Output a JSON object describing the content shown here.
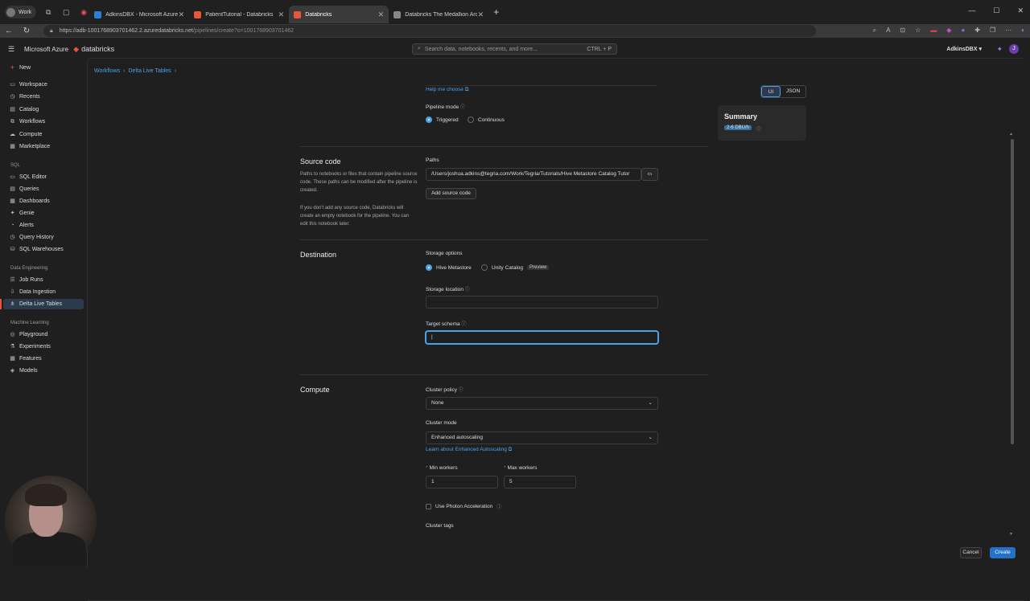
{
  "browser": {
    "profile": "Work",
    "tabs": [
      {
        "title": "AdkinsDBX - Microsoft Azure",
        "color": "#2b7fd6"
      },
      {
        "title": "PatientTutorial - Databricks",
        "color": "#e8553a"
      },
      {
        "title": "Databricks",
        "color": "#e8553a"
      },
      {
        "title": "Databricks The Medallion Archite",
        "color": "#888888"
      }
    ],
    "url_host": "https://adb-1001768903701462.2.azuredatabricks.net",
    "url_path": "/pipelines/create?o=1001768903701462"
  },
  "header": {
    "brand_azure": "Microsoft Azure",
    "brand_databricks": "databricks",
    "search_placeholder": "Search data, notebooks, recents, and more...",
    "search_shortcut": "CTRL + P",
    "account": "AdkinsDBX",
    "avatar_letter": "J"
  },
  "sidebar": {
    "new_label": "New",
    "items": [
      "Workspace",
      "Recents",
      "Catalog",
      "Workflows",
      "Compute",
      "Marketplace"
    ],
    "sql_section": "SQL",
    "sql_items": [
      "SQL Editor",
      "Queries",
      "Dashboards",
      "Genie",
      "Alerts",
      "Query History",
      "SQL Warehouses"
    ],
    "de_section": "Data Engineering",
    "de_items": [
      "Job Runs",
      "Data Ingestion",
      "Delta Live Tables"
    ],
    "ml_section": "Machine Learning",
    "ml_items": [
      "Playground",
      "Experiments",
      "Features",
      "Models"
    ]
  },
  "breadcrumbs": [
    "Workflows",
    "Delta Live Tables"
  ],
  "view_toggle": {
    "ui": "UI",
    "json": "JSON"
  },
  "summary": {
    "title": "Summary",
    "dbu": "2-6 DBU/h"
  },
  "form": {
    "help_link": "Help me choose",
    "pipeline_mode_label": "Pipeline mode",
    "mode_triggered": "Triggered",
    "mode_continuous": "Continuous",
    "source": {
      "title": "Source code",
      "desc1": "Paths to notebooks or files that contain pipeline source code. These paths can be modified after the pipeline is created.",
      "desc2": "If you don't add any source code, Databricks will create an empty notebook for the pipeline. You can edit this notebook later.",
      "paths_label": "Paths",
      "path_value": "/Users/joshua.adkins@tegria.com/Work/Tegria/Tutorials/Hive Metastore Catalog Tutor",
      "add_button": "Add source code"
    },
    "destination": {
      "title": "Destination",
      "storage_options_label": "Storage options",
      "hive": "Hive Metastore",
      "unity": "Unity Catalog",
      "preview": "Preview",
      "storage_location_label": "Storage location",
      "storage_location_value": "",
      "target_schema_label": "Target schema",
      "target_schema_value": ""
    },
    "compute": {
      "title": "Compute",
      "cluster_policy_label": "Cluster policy",
      "cluster_policy_value": "None",
      "cluster_mode_label": "Cluster mode",
      "cluster_mode_value": "Enhanced autoscaling",
      "learn_link": "Learn about Enhanced Autoscaling",
      "min_workers_label": "Min workers",
      "min_workers_value": "1",
      "max_workers_label": "Max workers",
      "max_workers_value": "5",
      "photon_label": "Use Photon Acceleration",
      "cluster_tags_label": "Cluster tags"
    }
  },
  "footer": {
    "cancel": "Cancel",
    "create": "Create"
  }
}
